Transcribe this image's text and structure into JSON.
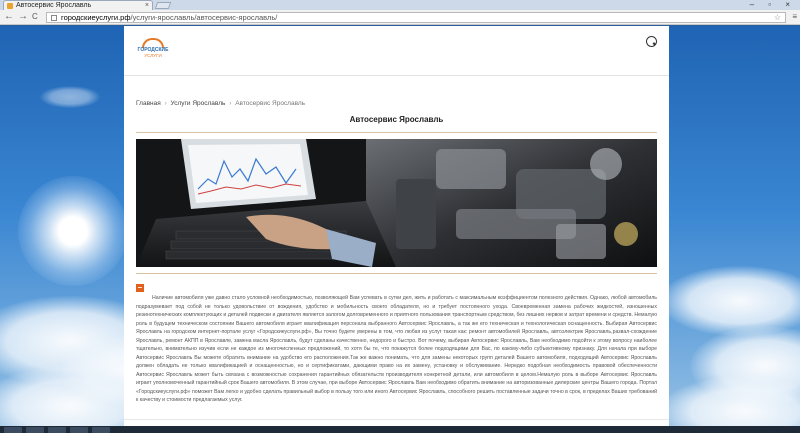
{
  "browser": {
    "tab_title": "Автосервис Ярославль",
    "tab_close": "×",
    "window_controls": "– ▫ ×",
    "back": "←",
    "forward": "→",
    "reload": "C",
    "url_host": "городскиеуслуги.рф",
    "url_path": "/услуги-ярославль/автосервис-ярославль/",
    "star": "☆",
    "menu": "≡"
  },
  "site": {
    "logo_line1": "ГОРОДСКИЕ",
    "logo_line2": "УСЛУГИ"
  },
  "breadcrumb": {
    "home": "Главная",
    "section": "Услуги Ярославль",
    "current": "Автосервис Ярославль",
    "separator": "›"
  },
  "page": {
    "title": "Автосервис Ярославль",
    "toggle_symbol": "–",
    "body": "Наличие автомобиля уже давно стало условной необходимостью, позволяющей Вам успевать в сутки дел, жить и работать с максимальным коэффициентом полезного действия. Однако, любой автомобиль подразумевает под собой не только удовольствие от вождения, удобство и мобильность своего обладателя, но и требует постоянного ухода. Своевременная замена рабочих жидкостей, изношенных резинотехнических комплектующих и деталей подвески и двигателя является залогом долговременного и приятного пользования транспортным средством, без лишних нервов и затрат времени и средств. Немалую роль в будущем техническом состоянии Вашего автомобиля играет квалификация персонала выбранного Автосервис Ярославль, а так же его техническая и технологическая оснащенность. Выбирая Автосервис Ярославль на городском интернет-портале услуг «Городскиеуслуги.рф», Вы точно будете уверены в том, что любая из услуг такая как: ремонт автомобилей Ярославль, автоэлектрик Ярославль,развал-схождение Ярославль, ремонт АКПП в Ярославле, замена масла Ярославль, будут сделаны качественно, недорого и быстро. Вот почему, выбирая Автосервис Ярославль, Вам необходимо подойти к этому вопросу наиболее тщательно, внимательно изучив если не каждое из многочисленных предложений, то хотя бы те, что покажутся более подходящими для Вас, по какому-либо субъективному признаку. Для начала при выборе Автосервис Ярославль Вы можете обратить внимание на удобство его расположения.Так же важно понимать, что для замены некоторых групп деталей Вашего автомобиля, подходящий Автосервис Ярославль должен обладать не только квалификацией и оснащенностью, но и сертификатами, дающими право на их замену, установку и обслуживание. Нередко подобная необходимость правовой обеспеченности Автосервис Ярославль может быть связана с возможностью сохранения гарантийных обязательств производителя конкретной детали, или автомобиля в целом.Немалую роль в выборе Автосервис Ярославль играет уполномоченный гарантийный срок Вашего автомобиля. В этом случае, при выборе Автосервис Ярославль Вам необходимо обратить внимание на авторизованные дилерские центры Вашего города. Портал «Городскиеуслуги.рф» поможет Вам легко и удобно сделать правильный выбор в пользу того или иного Автосервис Ярославль, способного решить поставленные задачи точно в срок, в пределах Ваших требований к качеству и стоимости предлагаемых услуг."
  },
  "colors": {
    "accent": "#e0601c",
    "brand_blue": "#2a6db0",
    "rule": "#d9c3a3"
  },
  "icons": {
    "search": "search-icon",
    "star": "star-icon",
    "menu": "menu-icon",
    "favicon": "favicon-icon"
  }
}
